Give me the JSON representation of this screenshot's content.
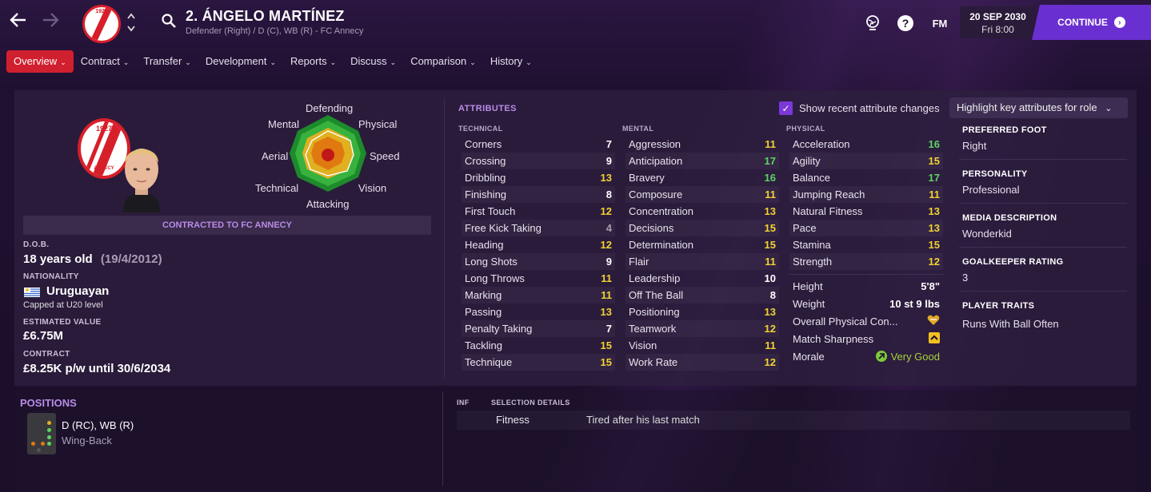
{
  "header": {
    "title": "2. ÁNGELO MARTÍNEZ",
    "subtitle": "Defender (Right) / D (C), WB (R) - FC Annecy",
    "crest_year": "1927",
    "crest_name": "ANNECY",
    "fm_label": "FM",
    "help_label": "?",
    "date": "20 SEP 2030",
    "time": "Fri 8:00",
    "continue_label": "CONTINUE"
  },
  "tabs": [
    {
      "label": "Overview",
      "active": true
    },
    {
      "label": "Contract"
    },
    {
      "label": "Transfer"
    },
    {
      "label": "Development"
    },
    {
      "label": "Reports"
    },
    {
      "label": "Discuss"
    },
    {
      "label": "Comparison"
    },
    {
      "label": "History"
    }
  ],
  "profile": {
    "contracted_to": "CONTRACTED TO FC ANNECY",
    "dob_label": "D.O.B.",
    "age": "18 years old",
    "dob": "(19/4/2012)",
    "nationality_label": "NATIONALITY",
    "nationality": "Uruguayan",
    "capped": "Capped at U20 level",
    "value_label": "ESTIMATED VALUE",
    "value": "£6.75M",
    "contract_label": "CONTRACT",
    "contract": "£8.25K p/w until 30/6/2034"
  },
  "radar": {
    "labels": {
      "top": "Defending",
      "top_left": "Mental",
      "top_right": "Physical",
      "left": "Aerial",
      "right": "Speed",
      "bottom_left": "Technical",
      "bottom_right": "Vision",
      "bottom": "Attacking"
    },
    "colors": [
      "#1d8a2b",
      "#38b23e",
      "#e0b020",
      "#e07a10",
      "#c01818"
    ]
  },
  "attributes": {
    "title": "ATTRIBUTES",
    "show_changes_label": "Show recent attribute changes",
    "show_changes_checked": true,
    "highlight_label": "Highlight key attributes for role",
    "technical_head": "TECHNICAL",
    "mental_head": "MENTAL",
    "physical_head": "PHYSICAL",
    "technical": [
      {
        "name": "Corners",
        "value": "7"
      },
      {
        "name": "Crossing",
        "value": "9"
      },
      {
        "name": "Dribbling",
        "value": "13"
      },
      {
        "name": "Finishing",
        "value": "8"
      },
      {
        "name": "First Touch",
        "value": "12"
      },
      {
        "name": "Free Kick Taking",
        "value": "4"
      },
      {
        "name": "Heading",
        "value": "12"
      },
      {
        "name": "Long Shots",
        "value": "9"
      },
      {
        "name": "Long Throws",
        "value": "11"
      },
      {
        "name": "Marking",
        "value": "11"
      },
      {
        "name": "Passing",
        "value": "13"
      },
      {
        "name": "Penalty Taking",
        "value": "7"
      },
      {
        "name": "Tackling",
        "value": "15"
      },
      {
        "name": "Technique",
        "value": "15"
      }
    ],
    "mental": [
      {
        "name": "Aggression",
        "value": "11"
      },
      {
        "name": "Anticipation",
        "value": "17"
      },
      {
        "name": "Bravery",
        "value": "16"
      },
      {
        "name": "Composure",
        "value": "11"
      },
      {
        "name": "Concentration",
        "value": "13"
      },
      {
        "name": "Decisions",
        "value": "15"
      },
      {
        "name": "Determination",
        "value": "15"
      },
      {
        "name": "Flair",
        "value": "11"
      },
      {
        "name": "Leadership",
        "value": "10"
      },
      {
        "name": "Off The Ball",
        "value": "8"
      },
      {
        "name": "Positioning",
        "value": "13"
      },
      {
        "name": "Teamwork",
        "value": "12"
      },
      {
        "name": "Vision",
        "value": "11"
      },
      {
        "name": "Work Rate",
        "value": "12"
      }
    ],
    "physical": [
      {
        "name": "Acceleration",
        "value": "16"
      },
      {
        "name": "Agility",
        "value": "15"
      },
      {
        "name": "Balance",
        "value": "17"
      },
      {
        "name": "Jumping Reach",
        "value": "11"
      },
      {
        "name": "Natural Fitness",
        "value": "13"
      },
      {
        "name": "Pace",
        "value": "13"
      },
      {
        "name": "Stamina",
        "value": "15"
      },
      {
        "name": "Strength",
        "value": "12"
      }
    ],
    "height_label": "Height",
    "height": "5'8\"",
    "weight_label": "Weight",
    "weight": "10 st 9 lbs",
    "condition_label": "Overall Physical Con...",
    "sharpness_label": "Match Sharpness",
    "morale_label": "Morale",
    "morale": "Very Good"
  },
  "info": {
    "foot_label": "PREFERRED FOOT",
    "foot": "Right",
    "personality_label": "PERSONALITY",
    "personality": "Professional",
    "media_label": "MEDIA DESCRIPTION",
    "media": "Wonderkid",
    "gk_label": "GOALKEEPER RATING",
    "gk": "3",
    "traits_label": "PLAYER TRAITS",
    "traits": "Runs With Ball Often"
  },
  "positions": {
    "title": "POSITIONS",
    "positions_text": "D (RC), WB (R)",
    "role": "Wing-Back"
  },
  "selection": {
    "inf_head": "INF",
    "details_head": "SELECTION DETAILS",
    "row_label": "Fitness",
    "row_value": "Tired after his last match"
  },
  "colors": {
    "accent_red": "#d0202f",
    "accent_purple": "#6a2fd0",
    "attr_yellow": "#f0d232",
    "attr_green": "#5ed45f"
  }
}
